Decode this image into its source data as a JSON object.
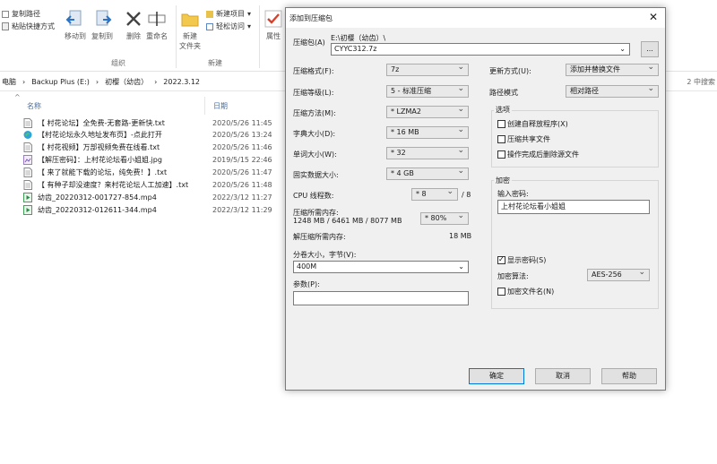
{
  "ribbon": {
    "copy_path": "复制路径",
    "paste_shortcut": "粘贴快捷方式",
    "move_to": "移动到",
    "copy_to": "复制到",
    "delete": "删除",
    "rename": "重命名",
    "new_folder_line1": "新建",
    "new_folder_line2": "文件夹",
    "new_item": "新建项目",
    "easy_access": "轻松访问",
    "properties": "属性",
    "group_organize": "组织",
    "group_new": "新建"
  },
  "address": {
    "crumbs": [
      "电脑",
      "Backup Plus (E:)",
      "初樱（幼齿）",
      "2022.3.12"
    ],
    "search_hint": "2 中搜索"
  },
  "columns": {
    "name": "名称",
    "date": "日期"
  },
  "files": [
    {
      "name": "【 村花论坛】全免费-无套路-更新快.txt",
      "date": "2020/5/26 11:45",
      "icon": "text-file-icon"
    },
    {
      "name": "【村花论坛永久地址发布页】-点此打开",
      "date": "2020/5/26 13:24",
      "icon": "edge-link-icon"
    },
    {
      "name": "【 村花视频】万部视频免费在线看.txt",
      "date": "2020/5/26 11:46",
      "icon": "text-file-icon"
    },
    {
      "name": "【解压密码】：上村花论坛看小姐姐.jpg",
      "date": "2019/5/15 22:46",
      "icon": "image-file-icon"
    },
    {
      "name": "【 来了就能下载的论坛，纯免费！】.txt",
      "date": "2020/5/26 11:47",
      "icon": "text-file-icon"
    },
    {
      "name": "【 有种子却没速度？来村花论坛人工加速】.txt",
      "date": "2020/5/26 11:48",
      "icon": "text-file-icon"
    },
    {
      "name": "幼齿_20220312-001727-854.mp4",
      "date": "2022/3/12 11:27",
      "icon": "video-file-icon"
    },
    {
      "name": "幼齿_20220312-012611-344.mp4",
      "date": "2022/3/12 11:29",
      "icon": "video-file-icon"
    }
  ],
  "dialog": {
    "title": "添加到压缩包",
    "archive_label": "压缩包(A)",
    "archive_path": "E:\\初樱（幼齿）\\",
    "archive_name": "CYYC312.7z",
    "browse": "...",
    "format_label": "压缩格式(F):",
    "format_value": "7z",
    "level_label": "压缩等级(L):",
    "level_value": "5 - 标准压缩",
    "method_label": "压缩方法(M):",
    "method_value": "* LZMA2",
    "dict_label": "字典大小(D):",
    "dict_value": "* 16 MB",
    "word_label": "单词大小(W):",
    "word_value": "* 32",
    "solid_label": "固实数据大小:",
    "solid_value": "* 4 GB",
    "threads_label": "CPU 线程数:",
    "threads_value": "* 8",
    "threads_max": "/ 8",
    "mem_label": "压缩所需内存:",
    "mem_value": "1248 MB / 6461 MB / 8077 MB",
    "mem_pct": "* 80%",
    "decomp_label": "解压缩所需内存:",
    "decomp_value": "18 MB",
    "split_label": "分卷大小，字节(V):",
    "split_value": "400M",
    "params_label": "参数(P):",
    "params_value": "",
    "update_label": "更新方式(U):",
    "update_value": "添加并替换文件",
    "pathmode_label": "路径模式",
    "pathmode_value": "相对路径",
    "options_title": "选项",
    "opt_sfx": "创建自释放程序(X)",
    "opt_shared": "压缩共享文件",
    "opt_delete": "操作完成后删除源文件",
    "enc_title": "加密",
    "pwd_label": "输入密码:",
    "pwd_value": "上村花论坛看小姐姐",
    "show_pwd": "显示密码(S)",
    "enc_method_label": "加密算法:",
    "enc_method_value": "AES-256",
    "enc_names": "加密文件名(N)",
    "ok": "确定",
    "cancel": "取消",
    "help": "帮助"
  },
  "colors": {
    "accent": "#0078d7",
    "dialog_bg": "#f0f0f0",
    "link_blue": "#4a6fa0"
  }
}
